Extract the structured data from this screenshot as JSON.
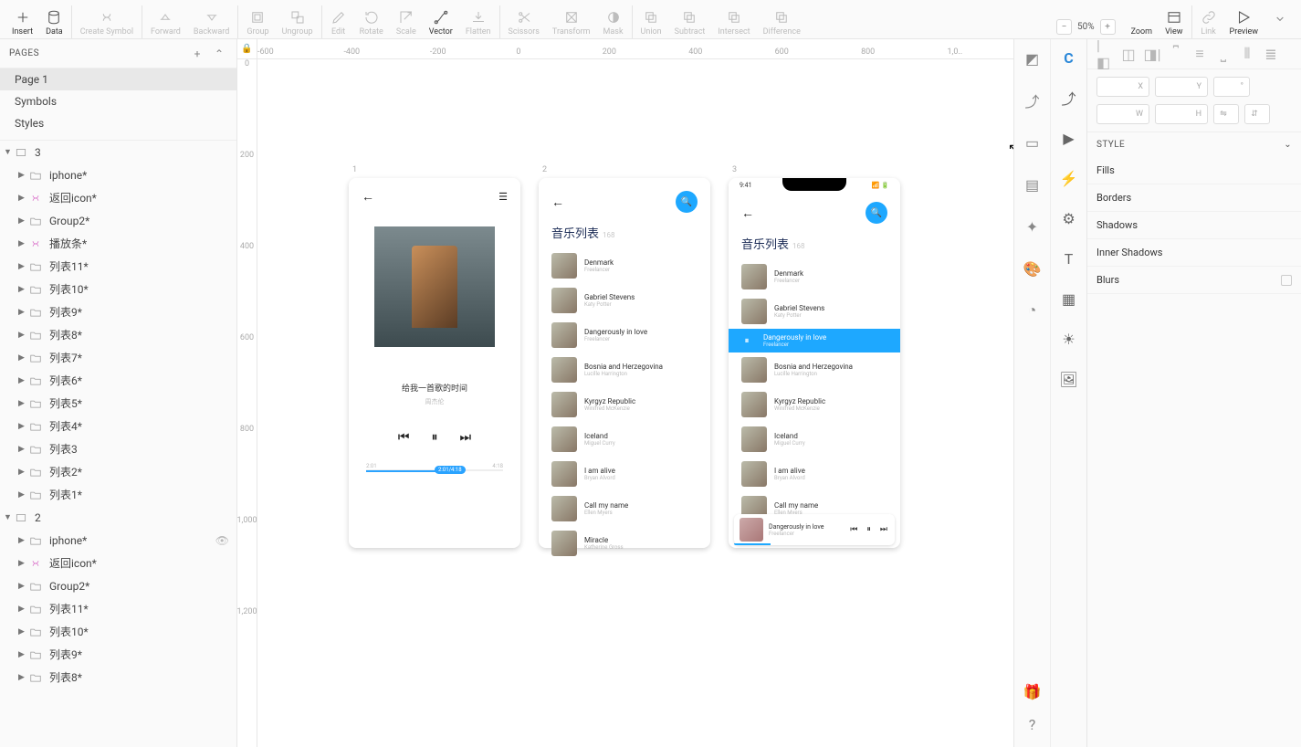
{
  "toolbar": {
    "insert": "Insert",
    "data": "Data",
    "create_symbol": "Create Symbol",
    "forward": "Forward",
    "backward": "Backward",
    "group": "Group",
    "ungroup": "Ungroup",
    "edit": "Edit",
    "rotate": "Rotate",
    "scale": "Scale",
    "vector": "Vector",
    "flatten": "Flatten",
    "scissors": "Scissors",
    "transform": "Transform",
    "mask": "Mask",
    "union": "Union",
    "subtract": "Subtract",
    "intersect": "Intersect",
    "difference": "Difference",
    "zoom": "Zoom",
    "zoom_value": "50%",
    "view": "View",
    "link": "Link",
    "preview": "Preview"
  },
  "sidebar": {
    "pages_title": "PAGES",
    "pages": [
      {
        "name": "Page 1",
        "selected": true
      },
      {
        "name": "Symbols"
      },
      {
        "name": "Styles"
      }
    ],
    "layers": [
      {
        "depth": 0,
        "kind": "artboard",
        "name": "3",
        "open": true
      },
      {
        "depth": 1,
        "kind": "folder",
        "name": "iphone*"
      },
      {
        "depth": 1,
        "kind": "symbol",
        "name": "返回icon*"
      },
      {
        "depth": 1,
        "kind": "folder",
        "name": "Group2*"
      },
      {
        "depth": 1,
        "kind": "symbol",
        "name": "播放条*"
      },
      {
        "depth": 1,
        "kind": "folder",
        "name": "列表11*"
      },
      {
        "depth": 1,
        "kind": "folder",
        "name": "列表10*"
      },
      {
        "depth": 1,
        "kind": "folder",
        "name": "列表9*"
      },
      {
        "depth": 1,
        "kind": "folder",
        "name": "列表8*"
      },
      {
        "depth": 1,
        "kind": "folder",
        "name": "列表7*"
      },
      {
        "depth": 1,
        "kind": "folder",
        "name": "列表6*"
      },
      {
        "depth": 1,
        "kind": "folder",
        "name": "列表5*"
      },
      {
        "depth": 1,
        "kind": "folder",
        "name": "列表4*"
      },
      {
        "depth": 1,
        "kind": "folder",
        "name": "列表3"
      },
      {
        "depth": 1,
        "kind": "folder",
        "name": "列表2*"
      },
      {
        "depth": 1,
        "kind": "folder",
        "name": "列表1*"
      },
      {
        "depth": 0,
        "kind": "artboard",
        "name": "2",
        "open": true
      },
      {
        "depth": 1,
        "kind": "folder",
        "name": "iphone*",
        "hidden": true
      },
      {
        "depth": 1,
        "kind": "symbol",
        "name": "返回icon*"
      },
      {
        "depth": 1,
        "kind": "folder",
        "name": "Group2*"
      },
      {
        "depth": 1,
        "kind": "folder",
        "name": "列表11*"
      },
      {
        "depth": 1,
        "kind": "folder",
        "name": "列表10*"
      },
      {
        "depth": 1,
        "kind": "folder",
        "name": "列表9*"
      },
      {
        "depth": 1,
        "kind": "folder",
        "name": "列表8*"
      }
    ]
  },
  "ruler": {
    "h": [
      "-600",
      "-400",
      "-200",
      "0",
      "200",
      "400",
      "600",
      "800",
      "1,0.."
    ],
    "v": [
      "0",
      "200",
      "400",
      "600",
      "800",
      "1,000",
      "1,200"
    ]
  },
  "canvas": {
    "artboards": {
      "a1": {
        "label": "1",
        "song_title": "给我一首歌的时间",
        "song_artist": "周杰伦",
        "time_left": "2:01",
        "time_right": "4:18",
        "time_tag": "2:01/4:18"
      },
      "a2": {
        "label": "2",
        "title": "音乐列表",
        "count": "168",
        "rows": [
          {
            "t": "Denmark",
            "a": "Freelancer"
          },
          {
            "t": "Gabriel Stevens",
            "a": "Katy Potter"
          },
          {
            "t": "Dangerously in love",
            "a": "Freelancer"
          },
          {
            "t": "Bosnia and Herzegovina",
            "a": "Lucille Harrington"
          },
          {
            "t": "Kyrgyz Republic",
            "a": "Winifred McKenzie"
          },
          {
            "t": "Iceland",
            "a": "Miguel Curry"
          },
          {
            "t": "I am alive",
            "a": "Bryan Alvord"
          },
          {
            "t": "Call my name",
            "a": "Ellen Myers"
          },
          {
            "t": "Miracle",
            "a": "Katherine Gross"
          }
        ]
      },
      "a3": {
        "label": "3",
        "status_time": "9:41",
        "title": "音乐列表",
        "count": "168",
        "rows": [
          {
            "t": "Denmark",
            "a": "Freelancer"
          },
          {
            "t": "Gabriel Stevens",
            "a": "Katy Potter"
          },
          {
            "t": "Dangerously in love",
            "a": "Freelancer",
            "active": true
          },
          {
            "t": "Bosnia and Herzegovina",
            "a": "Lucille Harrington"
          },
          {
            "t": "Kyrgyz Republic",
            "a": "Winifred McKenzie"
          },
          {
            "t": "Iceland",
            "a": "Miguel Curry"
          },
          {
            "t": "I am alive",
            "a": "Bryan Alvord"
          },
          {
            "t": "Call my name",
            "a": "Ellen Myers"
          }
        ],
        "nowbar": {
          "t": "Dangerously in love",
          "a": "Freelancer"
        }
      }
    }
  },
  "inspector": {
    "field_x": "X",
    "field_y": "Y",
    "field_ang": "°",
    "field_w": "W",
    "field_h": "H",
    "style": "STYLE",
    "sections": [
      "Fills",
      "Borders",
      "Shadows",
      "Inner Shadows",
      "Blurs"
    ]
  }
}
